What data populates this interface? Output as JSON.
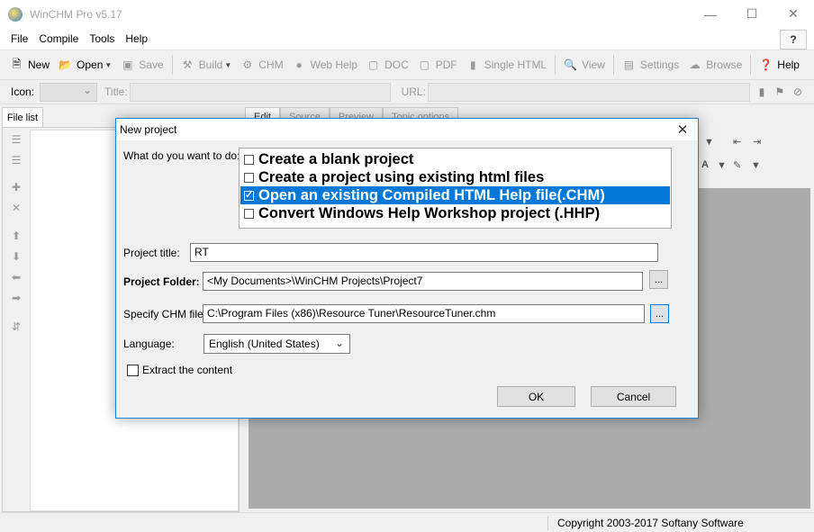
{
  "window": {
    "title": "WinCHM Pro v5.17",
    "controls": [
      "minimize",
      "maximize",
      "close"
    ]
  },
  "menu": {
    "items": [
      "File",
      "Compile",
      "Tools",
      "Help"
    ]
  },
  "toolbar": {
    "new": "New",
    "open": "Open",
    "save": "Save",
    "build": "Build",
    "chm": "CHM",
    "web_help": "Web Help",
    "doc": "DOC",
    "pdf": "PDF",
    "single_html": "Single HTML",
    "view": "View",
    "settings": "Settings",
    "browse": "Browse",
    "help": "Help"
  },
  "propbar": {
    "icon_label": "Icon:",
    "title_label": "Title:",
    "url_label": "URL:"
  },
  "left_panel": {
    "tab": "File list"
  },
  "editor": {
    "tabs": [
      "Edit",
      "Source",
      "Preview",
      "Topic options"
    ]
  },
  "status": {
    "copyright": "Copyright 2003-2017 Softany Software"
  },
  "dialog": {
    "title": "New project",
    "question": "What do you want to do:",
    "options": [
      {
        "label": "Create a blank project",
        "checked": false,
        "selected": false
      },
      {
        "label": "Create a project using existing html files",
        "checked": false,
        "selected": false
      },
      {
        "label": "Open an existing Compiled HTML Help file(.CHM)",
        "checked": true,
        "selected": true
      },
      {
        "label": "Convert Windows Help Workshop project (.HHP)",
        "checked": false,
        "selected": false
      }
    ],
    "project_title_label": "Project title:",
    "project_title_value": "RT",
    "project_folder_label": "Project Folder:",
    "project_folder_value": "<My Documents>\\WinCHM Projects\\Project7",
    "chm_file_label": "Specify CHM file:",
    "chm_file_value": "C:\\Program Files (x86)\\Resource Tuner\\ResourceTuner.chm",
    "browse_label": "...",
    "language_label": "Language:",
    "language_value": "English (United States)",
    "extract_label": "Extract the content",
    "extract_checked": false,
    "ok": "OK",
    "cancel": "Cancel"
  },
  "colors": {
    "selection": "#0078d7",
    "dialog_border": "#1883d7",
    "workspace": "#ababab"
  }
}
